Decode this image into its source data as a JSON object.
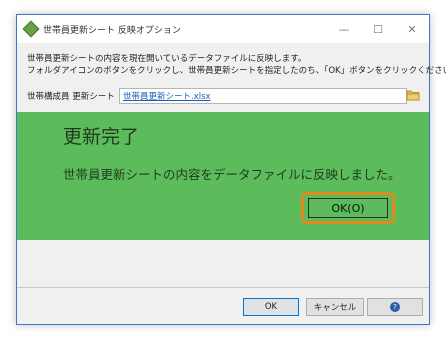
{
  "window": {
    "title": "世帯員更新シート 反映オプション",
    "controls": {
      "minimize": "—",
      "maximize": "☐",
      "close": "✕"
    }
  },
  "instructions": {
    "line1": "世帯員更新シートの内容を現在開いているデータファイルに反映します。",
    "line2": "フォルダアイコンのボタンをクリックし、世帯員更新シートを指定したのち、「OK」ボタンをクリックください。"
  },
  "file_field": {
    "label": "世帯構成員 更新シート",
    "value": "世帯員更新シート.xlsx"
  },
  "completion_overlay": {
    "title": "更新完了",
    "message": "世帯員更新シートの内容をデータファイルに反映しました。",
    "ok_label": "OK(O)",
    "background_color": "#5cbb5a",
    "highlight_color": "#e08a1e"
  },
  "buttons": {
    "ok": "OK",
    "cancel": "キャンセル",
    "help_icon": "?"
  }
}
